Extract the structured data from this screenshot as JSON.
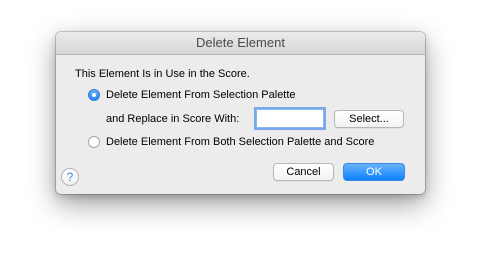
{
  "dialog": {
    "title": "Delete Element",
    "message": "This Element Is in Use in the Score.",
    "options": [
      {
        "label": "Delete Element From Selection Palette",
        "selected": true
      },
      {
        "label": "Delete Element From Both Selection Palette and Score",
        "selected": false
      }
    ],
    "replace_label": "and Replace in Score With:",
    "replace_value": "",
    "select_button": "Select...",
    "help_icon": "?",
    "cancel_button": "Cancel",
    "ok_button": "OK"
  },
  "colors": {
    "accent": "#2d86f3",
    "dialog_bg": "#ececec"
  }
}
